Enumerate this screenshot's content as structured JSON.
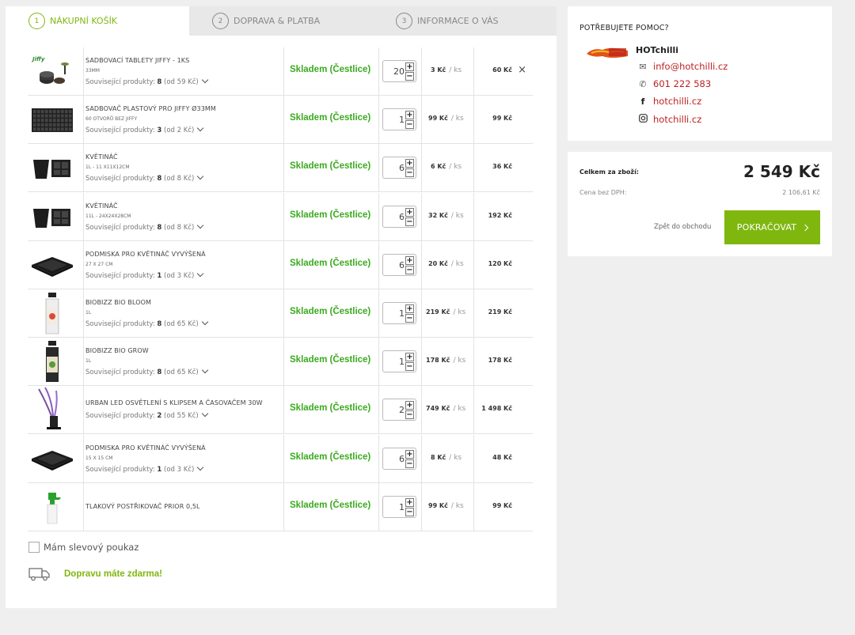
{
  "steps": [
    {
      "num": "1",
      "label": "NÁKUPNÍ KOŠÍK"
    },
    {
      "num": "2",
      "label": "DOPRAVA & PLATBA"
    },
    {
      "num": "3",
      "label": "INFORMACE O VÁS"
    }
  ],
  "items": [
    {
      "name": "SADBOVACÍ TABLETY JIFFY - 1KS",
      "variant": "33MM",
      "related_prefix": "Související produkty: ",
      "related_count": "8",
      "related_suffix": " (od 59 Kč)",
      "availability": "Skladem (Čestlice)",
      "qty": "20",
      "unit_price": "3 Kč",
      "per": "/ ks",
      "total": "60 Kč",
      "image": "jiffy-tablets"
    },
    {
      "name": "SADBOVAČ PLASTOVÝ PRO JIFFY Ø33MM",
      "variant": "60 OTVORŮ BEZ JIFFY",
      "related_prefix": "Související produkty: ",
      "related_count": "3",
      "related_suffix": " (od 2 Kč)",
      "availability": "Skladem (Čestlice)",
      "qty": "1",
      "unit_price": "99 Kč",
      "per": "/ ks",
      "total": "99 Kč",
      "image": "seed-tray"
    },
    {
      "name": "KVĚTINÁČ",
      "variant": "1L - 11 X11X12CM",
      "related_prefix": "Související produkty: ",
      "related_count": "8",
      "related_suffix": " (od 8 Kč)",
      "availability": "Skladem (Čestlice)",
      "qty": "6",
      "unit_price": "6 Kč",
      "per": "/ ks",
      "total": "36 Kč",
      "image": "pot"
    },
    {
      "name": "KVĚTINÁČ",
      "variant": "11L - 24X24X28CM",
      "related_prefix": "Související produkty: ",
      "related_count": "8",
      "related_suffix": " (od 8 Kč)",
      "availability": "Skladem (Čestlice)",
      "qty": "6",
      "unit_price": "32 Kč",
      "per": "/ ks",
      "total": "192 Kč",
      "image": "pot"
    },
    {
      "name": "PODMISKA PRO KVĚTINÁČ VYVÝŠENÁ",
      "variant": "27 X 27 CM",
      "related_prefix": "Související produkty: ",
      "related_count": "1",
      "related_suffix": " (od 3 Kč)",
      "availability": "Skladem (Čestlice)",
      "qty": "6",
      "unit_price": "20 Kč",
      "per": "/ ks",
      "total": "120 Kč",
      "image": "saucer"
    },
    {
      "name": "BIOBIZZ BIO BLOOM",
      "variant": "1L",
      "related_prefix": "Související produkty: ",
      "related_count": "8",
      "related_suffix": " (od 65 Kč)",
      "availability": "Skladem (Čestlice)",
      "qty": "1",
      "unit_price": "219 Kč",
      "per": "/ ks",
      "total": "219 Kč",
      "image": "bottle-bloom"
    },
    {
      "name": "BIOBIZZ BIO GROW",
      "variant": "1L",
      "related_prefix": "Související produkty: ",
      "related_count": "8",
      "related_suffix": " (od 65 Kč)",
      "availability": "Skladem (Čestlice)",
      "qty": "1",
      "unit_price": "178 Kč",
      "per": "/ ks",
      "total": "178 Kč",
      "image": "bottle-grow"
    },
    {
      "name": "URBAN LED OSVĚTLENÍ S KLIPSEM A ČASOVAČEM 30W",
      "variant": "",
      "related_prefix": "Související produkty: ",
      "related_count": "2",
      "related_suffix": " (od 55 Kč)",
      "availability": "Skladem (Čestlice)",
      "qty": "2",
      "unit_price": "749 Kč",
      "per": "/ ks",
      "total": "1 498 Kč",
      "image": "led-lamp"
    },
    {
      "name": "PODMISKA PRO KVĚTINÁČ VYVÝŠENÁ",
      "variant": "15 X 15 CM",
      "related_prefix": "Související produkty: ",
      "related_count": "1",
      "related_suffix": " (od 3 Kč)",
      "availability": "Skladem (Čestlice)",
      "qty": "6",
      "unit_price": "8 Kč",
      "per": "/ ks",
      "total": "48 Kč",
      "image": "saucer"
    },
    {
      "name": "TLAKOVÝ POSTŘIKOVAČ PRIOR 0,5L",
      "variant": "",
      "related_prefix": "",
      "related_count": "",
      "related_suffix": "",
      "availability": "Skladem (Čestlice)",
      "qty": "1",
      "unit_price": "99 Kč",
      "per": "/ ks",
      "total": "99 Kč",
      "image": "sprayer"
    }
  ],
  "voucher_label": "Mám slevový poukaz",
  "free_shipping": "Dopravu máte zdarma!",
  "help": {
    "title": "POTŘEBUJETE POMOC?",
    "brand": "HOTchilli",
    "email": "info@hotchilli.cz",
    "phone": "601 222 583",
    "facebook": "hotchilli.cz",
    "instagram": "hotchilli.cz"
  },
  "summary": {
    "total_label": "Celkem za zboží:",
    "total": "2 549 Kč",
    "vat_label": "Cena bez DPH:",
    "vat_value": "2 106,61 Kč",
    "back_label": "Zpět do obchodu",
    "continue_label": "POKRAČOVAT"
  },
  "colors": {
    "accent": "#7fb70f",
    "stock": "#3aaa1e",
    "link": "#b22222",
    "background": "#efefef"
  }
}
